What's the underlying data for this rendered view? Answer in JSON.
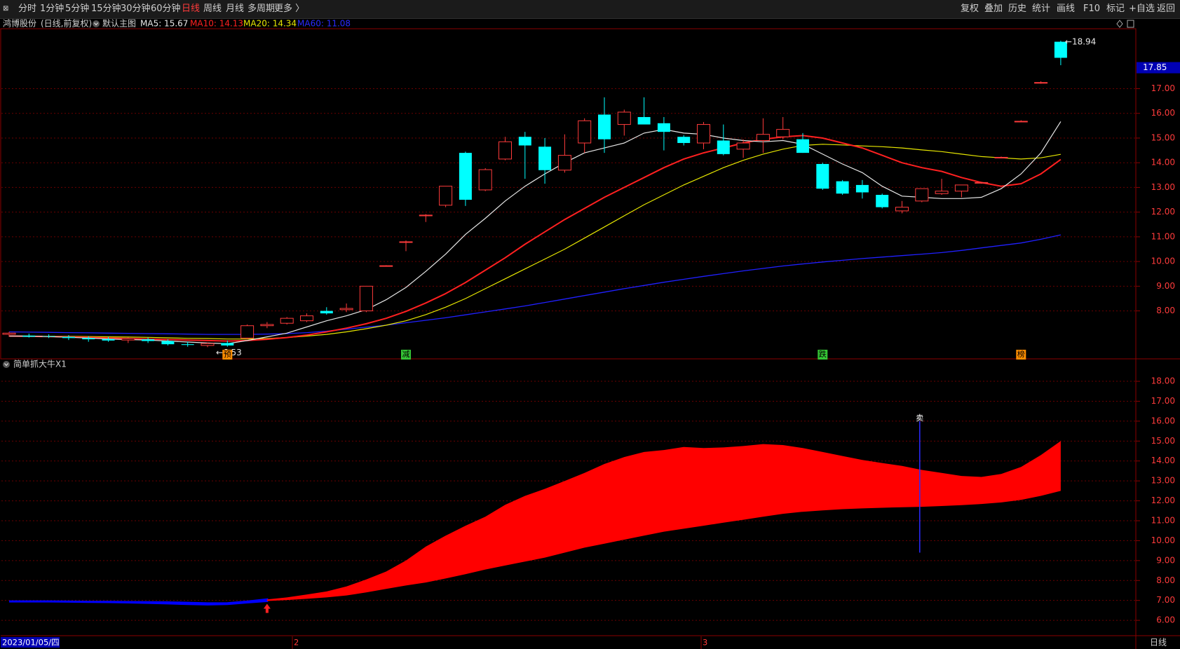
{
  "toolbar": {
    "left_tabs": [
      "分时",
      "1分钟",
      "5分钟",
      "15分钟",
      "30分钟",
      "60分钟",
      "日线",
      "周线",
      "月线",
      "多周期",
      "更多 〉"
    ],
    "active_tab": "日线",
    "right_buttons": [
      "复权",
      "叠加",
      "历史",
      "统计",
      "画线",
      "F10",
      "标记",
      "+自选",
      "返回"
    ]
  },
  "colors": {
    "up": "#ff3b3b",
    "down": "#00ffff",
    "ma5": "#e6e6e6",
    "ma10": "#ff2020",
    "ma20": "#e6e600",
    "ma60": "#2020ff",
    "frame": "#8b0000",
    "band": "#ff0000",
    "band_pre": "#0000ff"
  },
  "main_panel": {
    "stock_name": "鸿博股份",
    "mode": "(日线,前复权)",
    "template": "默认主图",
    "ma5_label": "MA5: 15.67",
    "ma10_label": "MA10: 14.13",
    "ma20_label": "MA20: 14.34",
    "ma60_label": "MA60: 11.08",
    "high_label": "18.94",
    "low_label": "6.53",
    "current_price": "17.85",
    "y_ticks": [
      "17.00",
      "16.00",
      "15.00",
      "14.00",
      "13.00",
      "12.00",
      "11.00",
      "10.00",
      "9.00",
      "8.00"
    ],
    "y_tick_values": [
      17,
      16,
      15,
      14,
      13,
      12,
      11,
      10,
      9,
      8
    ],
    "signals": [
      {
        "text": "预",
        "index": 11,
        "color": "#ff8c00"
      },
      {
        "text": "减",
        "index": 20,
        "color": "#35c435"
      },
      {
        "text": "跌",
        "index": 41,
        "color": "#35c435"
      },
      {
        "text": "榜",
        "index": 51,
        "color": "#ff8c00"
      }
    ],
    "ylim": [
      6.2,
      19.2
    ]
  },
  "sub_panel": {
    "title": "简单抓大牛X1",
    "y_ticks": [
      "18.00",
      "17.00",
      "16.00",
      "15.00",
      "14.00",
      "13.00",
      "12.00",
      "11.00",
      "10.00",
      "9.00",
      "8.00",
      "7.00",
      "6.00"
    ],
    "y_tick_values": [
      18,
      17,
      16,
      15,
      14,
      13,
      12,
      11,
      10,
      9,
      8,
      7,
      6
    ],
    "sell_label": "卖",
    "sell_index": 46,
    "buy_index": 13,
    "ylim": [
      5.3,
      18.6
    ]
  },
  "bottom_bar": {
    "date": "2023/01/05/四",
    "month_2": "2",
    "month_3": "3",
    "period": "日线"
  },
  "chart_data": {
    "type": "candlestick",
    "note_series": "open/high/low/close per session in price units",
    "ohlc": [
      [
        7.05,
        7.15,
        6.95,
        7.1
      ],
      [
        7.0,
        7.08,
        6.92,
        6.95
      ],
      [
        6.98,
        7.05,
        6.9,
        6.97
      ],
      [
        6.95,
        7.02,
        6.82,
        6.9
      ],
      [
        6.9,
        6.98,
        6.75,
        6.85
      ],
      [
        6.86,
        6.95,
        6.75,
        6.8
      ],
      [
        6.82,
        6.92,
        6.7,
        6.88
      ],
      [
        6.85,
        6.92,
        6.7,
        6.78
      ],
      [
        6.78,
        6.85,
        6.6,
        6.65
      ],
      [
        6.65,
        6.75,
        6.55,
        6.62
      ],
      [
        6.6,
        6.72,
        6.53,
        6.68
      ],
      [
        6.7,
        6.8,
        6.55,
        6.6
      ],
      [
        6.9,
        7.45,
        6.85,
        7.4
      ],
      [
        7.4,
        7.55,
        7.3,
        7.45
      ],
      [
        7.5,
        7.75,
        7.45,
        7.7
      ],
      [
        7.6,
        7.9,
        7.55,
        7.8
      ],
      [
        8.0,
        8.15,
        7.85,
        7.9
      ],
      [
        8.05,
        8.3,
        7.95,
        8.1
      ],
      [
        8.0,
        9.0,
        7.95,
        9.0
      ],
      [
        9.82,
        9.85,
        9.8,
        9.83
      ],
      [
        10.78,
        10.85,
        10.42,
        10.8
      ],
      [
        11.85,
        11.92,
        11.6,
        11.88
      ],
      [
        12.28,
        13.05,
        12.2,
        13.05
      ],
      [
        14.4,
        14.45,
        12.25,
        12.5
      ],
      [
        12.9,
        13.78,
        12.85,
        13.72
      ],
      [
        14.15,
        15.05,
        14.1,
        14.85
      ],
      [
        15.05,
        15.25,
        13.35,
        14.7
      ],
      [
        14.65,
        15.0,
        13.15,
        13.7
      ],
      [
        13.7,
        15.15,
        13.6,
        14.3
      ],
      [
        14.8,
        15.8,
        14.4,
        15.7
      ],
      [
        15.95,
        16.65,
        14.4,
        14.95
      ],
      [
        15.55,
        16.15,
        15.1,
        16.05
      ],
      [
        15.85,
        16.65,
        15.6,
        15.55
      ],
      [
        15.6,
        15.85,
        14.5,
        15.25
      ],
      [
        15.05,
        15.12,
        14.7,
        14.8
      ],
      [
        14.8,
        15.65,
        14.55,
        15.55
      ],
      [
        14.9,
        15.55,
        14.3,
        14.35
      ],
      [
        14.55,
        14.95,
        14.2,
        14.8
      ],
      [
        14.9,
        15.8,
        14.4,
        15.15
      ],
      [
        15.05,
        15.85,
        14.95,
        15.35
      ],
      [
        14.95,
        15.2,
        14.4,
        14.4
      ],
      [
        13.95,
        14.0,
        12.9,
        12.95
      ],
      [
        13.25,
        13.3,
        12.7,
        12.75
      ],
      [
        13.1,
        13.3,
        12.55,
        12.8
      ],
      [
        12.7,
        12.75,
        12.15,
        12.2
      ],
      [
        12.05,
        12.45,
        11.95,
        12.2
      ],
      [
        12.45,
        12.9,
        12.4,
        12.95
      ],
      [
        12.75,
        13.35,
        12.7,
        12.85
      ],
      [
        12.85,
        13.05,
        12.6,
        13.1
      ],
      [
        13.18,
        13.22,
        13.15,
        13.2
      ],
      [
        14.2,
        14.25,
        14.18,
        14.22
      ],
      [
        15.68,
        15.72,
        15.65,
        15.68
      ],
      [
        17.25,
        17.3,
        17.2,
        17.25
      ],
      [
        18.9,
        18.94,
        17.95,
        18.25
      ]
    ],
    "ma5": [
      6.98,
      6.98,
      6.96,
      6.93,
      6.9,
      6.86,
      6.84,
      6.82,
      6.78,
      6.74,
      6.7,
      6.67,
      6.8,
      6.95,
      7.1,
      7.35,
      7.6,
      7.8,
      8.05,
      8.45,
      8.95,
      9.6,
      10.3,
      11.1,
      11.75,
      12.45,
      13.05,
      13.55,
      14.0,
      14.4,
      14.6,
      14.8,
      15.2,
      15.35,
      15.2,
      15.15,
      15.0,
      14.9,
      14.85,
      14.9,
      14.75,
      14.35,
      13.95,
      13.6,
      13.05,
      12.65,
      12.6,
      12.55,
      12.55,
      12.6,
      12.95,
      13.55,
      14.4,
      15.67
    ],
    "ma10": [
      6.98,
      6.97,
      6.96,
      6.95,
      6.93,
      6.9,
      6.88,
      6.86,
      6.84,
      6.82,
      6.8,
      6.78,
      6.8,
      6.85,
      6.92,
      7.02,
      7.15,
      7.3,
      7.48,
      7.7,
      7.98,
      8.32,
      8.7,
      9.15,
      9.65,
      10.15,
      10.7,
      11.2,
      11.7,
      12.15,
      12.6,
      13.0,
      13.4,
      13.8,
      14.15,
      14.4,
      14.6,
      14.8,
      14.95,
      15.05,
      15.1,
      15.0,
      14.8,
      14.6,
      14.3,
      14.0,
      13.8,
      13.65,
      13.4,
      13.2,
      13.05,
      13.15,
      13.55,
      14.13
    ],
    "ma20": [
      6.98,
      6.98,
      6.97,
      6.97,
      6.96,
      6.95,
      6.94,
      6.93,
      6.91,
      6.89,
      6.88,
      6.86,
      6.86,
      6.88,
      6.92,
      6.98,
      7.05,
      7.15,
      7.28,
      7.42,
      7.6,
      7.85,
      8.15,
      8.5,
      8.9,
      9.3,
      9.7,
      10.1,
      10.5,
      10.95,
      11.4,
      11.85,
      12.3,
      12.7,
      13.1,
      13.45,
      13.8,
      14.1,
      14.35,
      14.55,
      14.7,
      14.75,
      14.72,
      14.68,
      14.65,
      14.6,
      14.52,
      14.45,
      14.35,
      14.25,
      14.2,
      14.15,
      14.2,
      14.34
    ],
    "ma60": [
      7.15,
      7.14,
      7.13,
      7.12,
      7.11,
      7.1,
      7.09,
      7.08,
      7.07,
      7.06,
      7.05,
      7.05,
      7.05,
      7.06,
      7.08,
      7.12,
      7.18,
      7.26,
      7.34,
      7.42,
      7.52,
      7.62,
      7.72,
      7.84,
      7.96,
      8.08,
      8.2,
      8.34,
      8.48,
      8.62,
      8.76,
      8.9,
      9.03,
      9.16,
      9.28,
      9.4,
      9.51,
      9.62,
      9.72,
      9.82,
      9.9,
      9.98,
      10.05,
      10.12,
      10.18,
      10.24,
      10.3,
      10.36,
      10.45,
      10.55,
      10.65,
      10.75,
      10.9,
      11.08
    ],
    "band_upper": [
      6.95,
      6.95,
      6.95,
      6.94,
      6.93,
      6.93,
      6.92,
      6.91,
      6.9,
      6.88,
      6.85,
      6.86,
      6.94,
      7.05,
      7.15,
      7.3,
      7.45,
      7.7,
      8.05,
      8.45,
      9.0,
      9.7,
      10.25,
      10.75,
      11.2,
      11.8,
      12.25,
      12.6,
      13.0,
      13.4,
      13.85,
      14.2,
      14.45,
      14.55,
      14.7,
      14.65,
      14.68,
      14.75,
      14.85,
      14.8,
      14.65,
      14.45,
      14.25,
      14.05,
      13.9,
      13.75,
      13.55,
      13.4,
      13.25,
      13.2,
      13.35,
      13.7,
      14.3,
      15.0
    ],
    "band_lower": [
      6.95,
      6.95,
      6.95,
      6.94,
      6.93,
      6.92,
      6.9,
      6.88,
      6.85,
      6.82,
      6.8,
      6.82,
      6.9,
      6.97,
      7.02,
      7.08,
      7.15,
      7.25,
      7.4,
      7.58,
      7.75,
      7.9,
      8.1,
      8.32,
      8.55,
      8.75,
      8.95,
      9.15,
      9.4,
      9.65,
      9.85,
      10.05,
      10.25,
      10.45,
      10.6,
      10.75,
      10.9,
      11.05,
      11.2,
      11.35,
      11.45,
      11.52,
      11.58,
      11.62,
      11.65,
      11.68,
      11.7,
      11.74,
      11.78,
      11.84,
      11.92,
      12.05,
      12.25,
      12.5
    ]
  }
}
